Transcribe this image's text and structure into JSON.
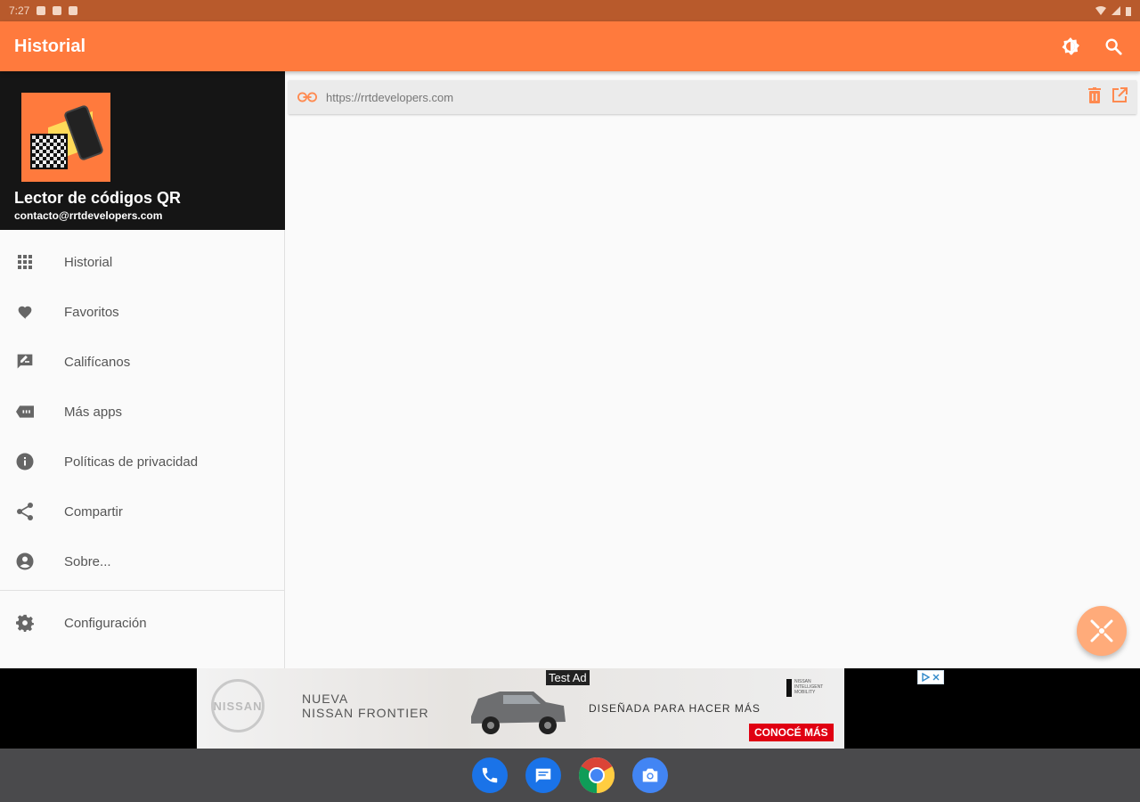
{
  "status_bar": {
    "time": "7:27"
  },
  "app_bar": {
    "title": "Historial"
  },
  "drawer": {
    "app_name": "Lector de códigos QR",
    "email": "contacto@rrtdevelopers.com",
    "items": [
      {
        "label": "Historial",
        "icon": "grid-icon"
      },
      {
        "label": "Favoritos",
        "icon": "heart-icon"
      },
      {
        "label": "Califícanos",
        "icon": "rate-review-icon"
      },
      {
        "label": "Más apps",
        "icon": "store-icon"
      },
      {
        "label": "Políticas de privacidad",
        "icon": "info-icon"
      },
      {
        "label": "Compartir",
        "icon": "share-icon"
      },
      {
        "label": "Sobre...",
        "icon": "account-icon"
      }
    ],
    "settings_label": "Configuración"
  },
  "history": {
    "entries": [
      {
        "url": "https://rrtdevelopers.com",
        "type": "link"
      }
    ]
  },
  "ad": {
    "label": "Test Ad",
    "brand": "NISSAN",
    "line1": "NUEVA",
    "line2": "NISSAN FRONTIER",
    "tagline": "DISEÑADA PARA HACER MÁS",
    "cta": "CONOCÉ MÁS",
    "badge": "NISSAN INTELLIGENT MOBILITY"
  },
  "colors": {
    "primary": "#ff7a3d",
    "status_bar": "#b85a2c",
    "drawer_header": "#151515",
    "fab": "#ffab7a",
    "icon_gray": "#666666"
  }
}
